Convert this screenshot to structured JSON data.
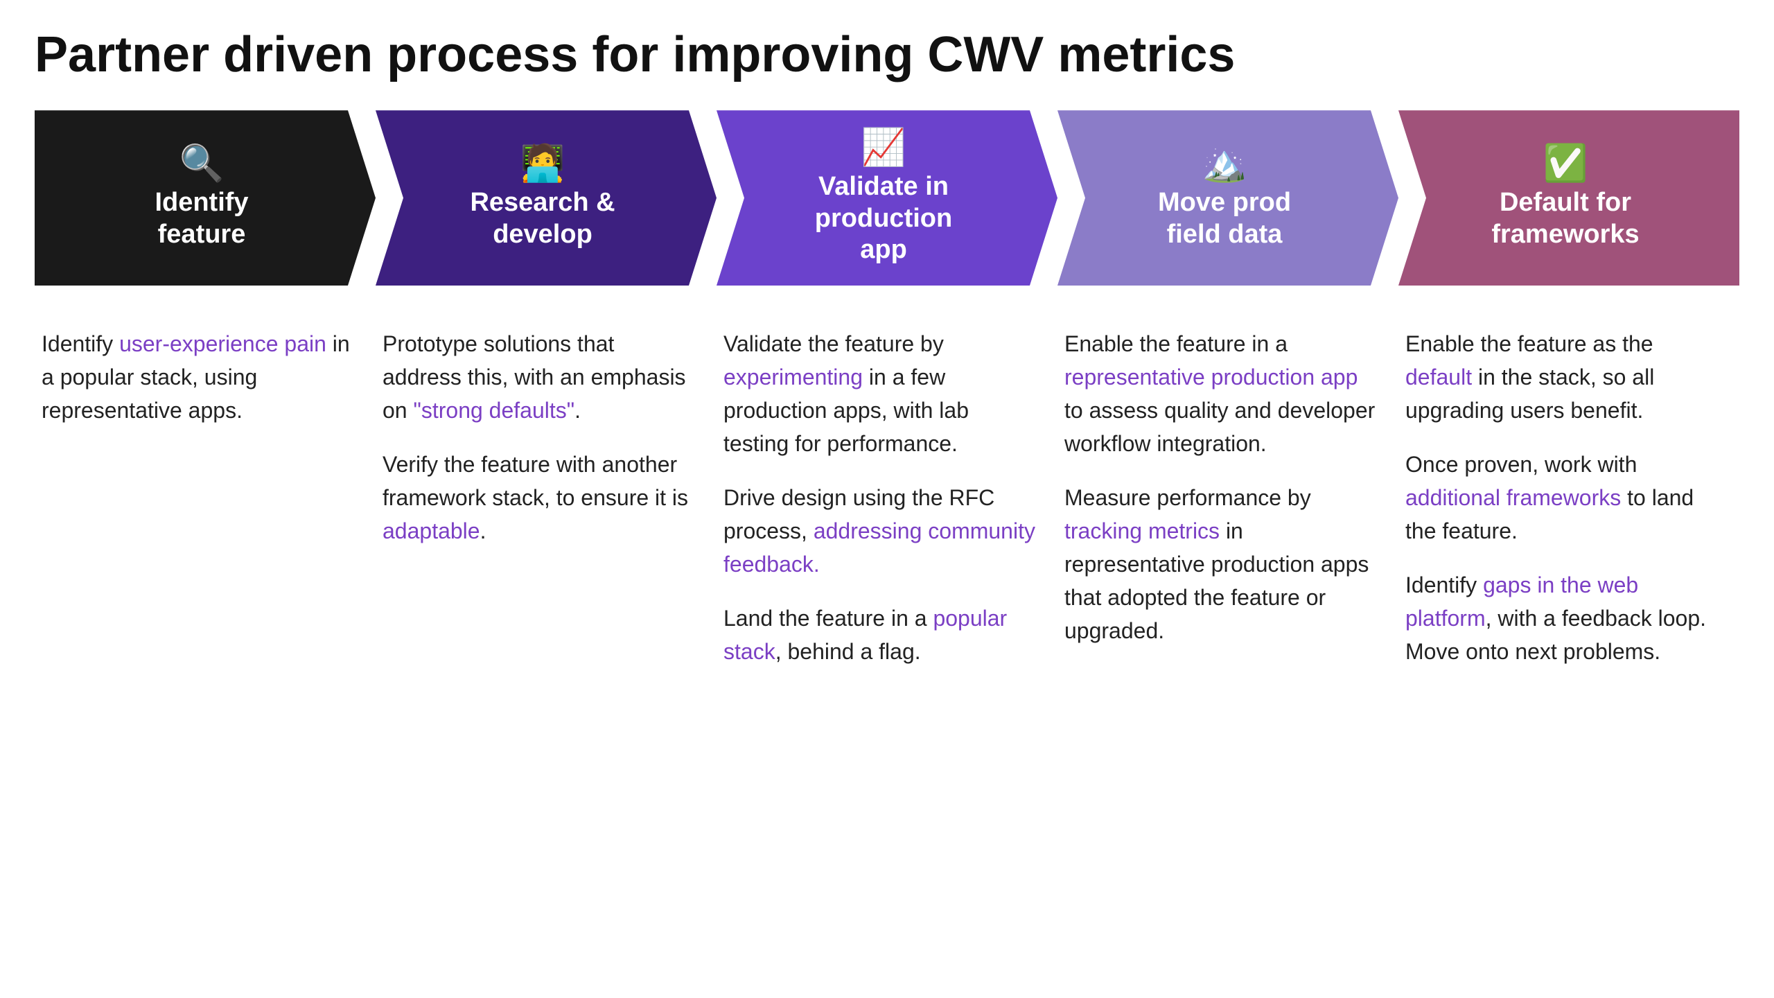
{
  "page": {
    "title": "Partner driven process for improving CWV metrics"
  },
  "arrows": [
    {
      "id": "identify",
      "icon": "🔍",
      "title": "Identify\nfeature",
      "colorClass": "arrow-0"
    },
    {
      "id": "research",
      "icon": "🧑‍💻",
      "title": "Research &\ndevelop",
      "colorClass": "arrow-1"
    },
    {
      "id": "validate",
      "icon": "📈",
      "title": "Validate in\nproduction\napp",
      "colorClass": "arrow-2"
    },
    {
      "id": "move",
      "icon": "🏔️",
      "title": "Move prod\nfield data",
      "colorClass": "arrow-3"
    },
    {
      "id": "default",
      "icon": "✅",
      "title": "Default for\nframeworks",
      "colorClass": "arrow-4"
    }
  ],
  "columns": [
    {
      "id": "identify-content",
      "paragraphs": [
        {
          "parts": [
            {
              "text": "Identify ",
              "type": "plain"
            },
            {
              "text": "user-experience pain",
              "type": "link"
            },
            {
              "text": " in a popular stack, using representative apps.",
              "type": "plain"
            }
          ]
        }
      ]
    },
    {
      "id": "research-content",
      "paragraphs": [
        {
          "parts": [
            {
              "text": "Prototype solutions that address this, with an emphasis on ",
              "type": "plain"
            },
            {
              "text": "“strong defaults”",
              "type": "link"
            },
            {
              "text": ".",
              "type": "plain"
            }
          ]
        },
        {
          "parts": [
            {
              "text": "Verify the feature with another framework stack, to ensure it is ",
              "type": "plain"
            },
            {
              "text": "adaptable",
              "type": "link"
            },
            {
              "text": ".",
              "type": "plain"
            }
          ]
        }
      ]
    },
    {
      "id": "validate-content",
      "paragraphs": [
        {
          "parts": [
            {
              "text": "Validate the feature by ",
              "type": "plain"
            },
            {
              "text": "experimenting",
              "type": "link"
            },
            {
              "text": " in a few production apps, with lab testing for performance.",
              "type": "plain"
            }
          ]
        },
        {
          "parts": [
            {
              "text": "Drive design using the RFC process, ",
              "type": "plain"
            },
            {
              "text": "addressing community feedback.",
              "type": "link"
            }
          ]
        },
        {
          "parts": [
            {
              "text": "Land the feature in a ",
              "type": "plain"
            },
            {
              "text": "popular stack",
              "type": "link"
            },
            {
              "text": ", behind a flag.",
              "type": "plain"
            }
          ]
        }
      ]
    },
    {
      "id": "move-content",
      "paragraphs": [
        {
          "parts": [
            {
              "text": "Enable the feature in a ",
              "type": "plain"
            },
            {
              "text": "representative production app",
              "type": "link"
            },
            {
              "text": " to assess quality and developer workflow integration.",
              "type": "plain"
            }
          ]
        },
        {
          "parts": [
            {
              "text": "Measure performance by ",
              "type": "plain"
            },
            {
              "text": "tracking metrics",
              "type": "link"
            },
            {
              "text": " in representative production apps that adopted the feature or upgraded.",
              "type": "plain"
            }
          ]
        }
      ]
    },
    {
      "id": "default-content",
      "paragraphs": [
        {
          "parts": [
            {
              "text": "Enable the feature as the ",
              "type": "plain"
            },
            {
              "text": "default",
              "type": "link"
            },
            {
              "text": " in the stack, so all upgrading users benefit.",
              "type": "plain"
            }
          ]
        },
        {
          "parts": [
            {
              "text": "Once proven, work with ",
              "type": "plain"
            },
            {
              "text": "additional frameworks",
              "type": "link"
            },
            {
              "text": " to land the feature.",
              "type": "plain"
            }
          ]
        },
        {
          "parts": [
            {
              "text": "Identify ",
              "type": "plain"
            },
            {
              "text": "gaps in the web platform",
              "type": "link"
            },
            {
              "text": ", with a feedback loop. Move onto next problems.",
              "type": "plain"
            }
          ]
        }
      ]
    }
  ]
}
